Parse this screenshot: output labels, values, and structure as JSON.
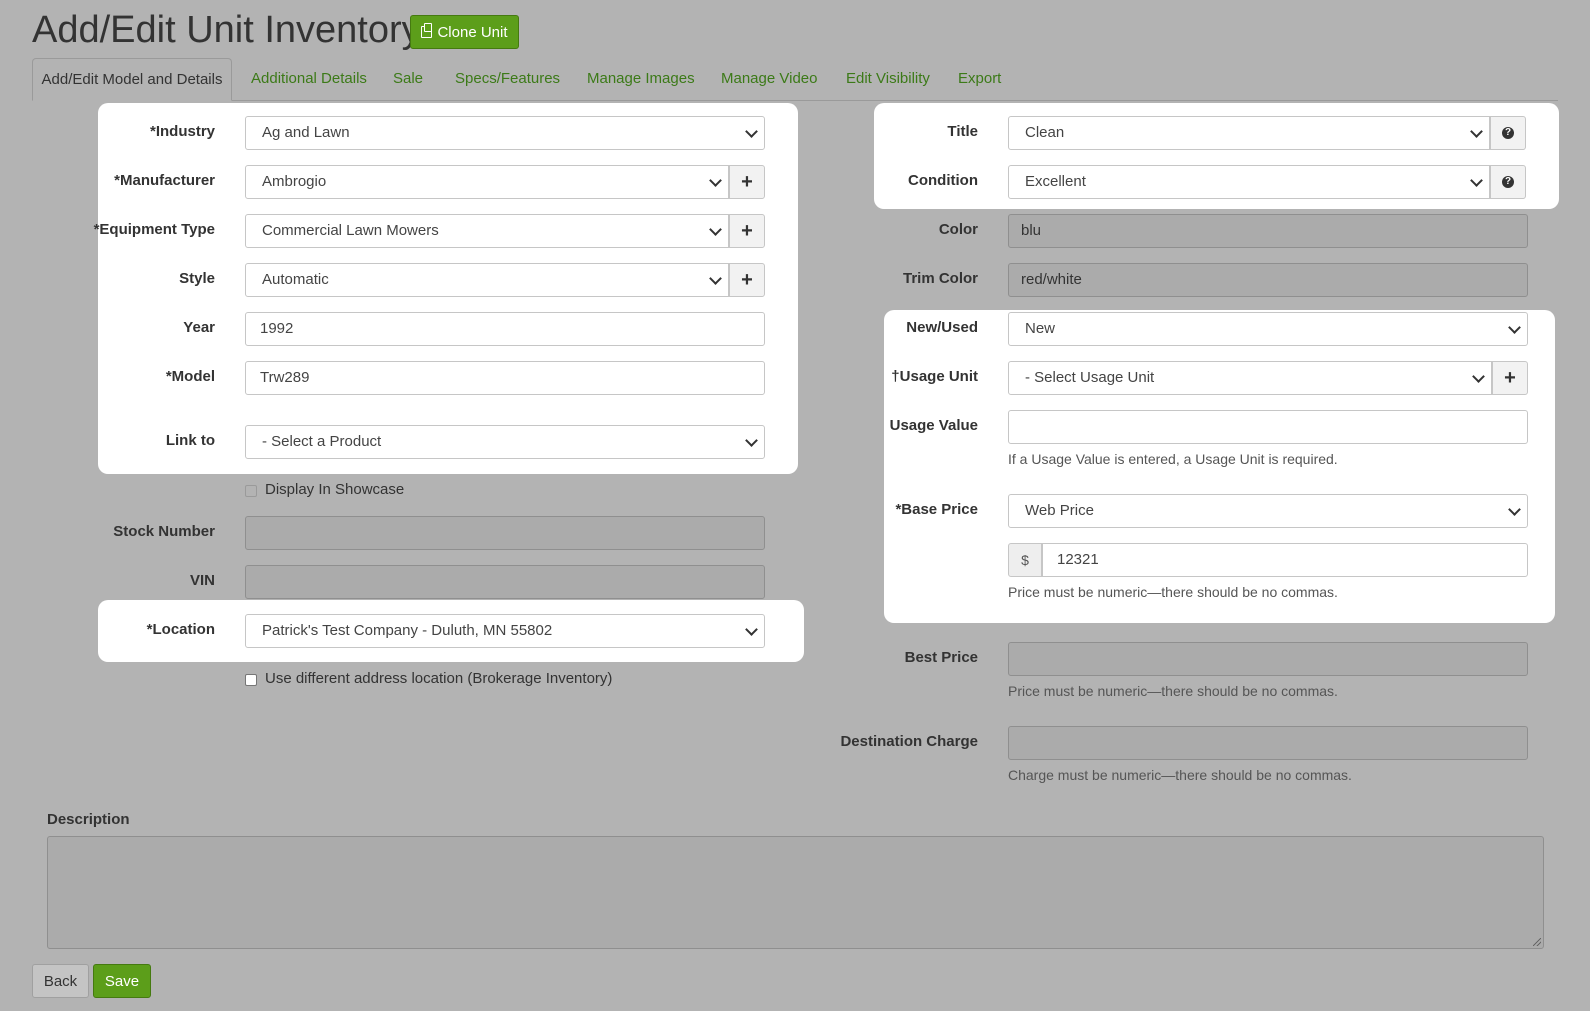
{
  "page": {
    "title": "Add/Edit Unit Inventory",
    "clone_button": "Clone Unit"
  },
  "tabs": [
    {
      "label": "Add/Edit Model and Details",
      "active": true
    },
    {
      "label": "Additional Details"
    },
    {
      "label": "Sale"
    },
    {
      "label": "Specs/Features"
    },
    {
      "label": "Manage Images"
    },
    {
      "label": "Manage Video"
    },
    {
      "label": "Edit Visibility"
    },
    {
      "label": "Export"
    }
  ],
  "left": {
    "industry": {
      "label": "*Industry",
      "value": "Ag and Lawn"
    },
    "manufacturer": {
      "label": "*Manufacturer",
      "value": "Ambrogio"
    },
    "equipment_type": {
      "label": "*Equipment Type",
      "value": "Commercial Lawn Mowers"
    },
    "style": {
      "label": "Style",
      "value": "Automatic"
    },
    "year": {
      "label": "Year",
      "value": "1992"
    },
    "model": {
      "label": "*Model",
      "value": "Trw289"
    },
    "link_to": {
      "label": "Link to",
      "value": "- Select a Product"
    },
    "display_showcase": {
      "label": "Display In Showcase",
      "checked": false
    },
    "stock_number": {
      "label": "Stock Number",
      "value": ""
    },
    "vin": {
      "label": "VIN",
      "value": ""
    },
    "location": {
      "label": "*Location",
      "value": "Patrick's Test Company - Duluth, MN 55802"
    },
    "different_address": {
      "label": "Use different address location (Brokerage Inventory)",
      "checked": false
    }
  },
  "right": {
    "title": {
      "label": "Title",
      "value": "Clean"
    },
    "condition": {
      "label": "Condition",
      "value": "Excellent"
    },
    "color": {
      "label": "Color",
      "value": "blu"
    },
    "trim_color": {
      "label": "Trim Color",
      "value": "red/white"
    },
    "new_used": {
      "label": "New/Used",
      "value": "New"
    },
    "usage_unit": {
      "label": "†Usage Unit",
      "value": "- Select Usage Unit"
    },
    "usage_value": {
      "label": "Usage Value",
      "value": "",
      "help": "If a Usage Value is entered, a Usage Unit is required."
    },
    "base_price": {
      "label": "*Base Price",
      "value": "Web Price",
      "currency": "$",
      "amount": "12321",
      "help": "Price must be numeric—there should be no commas."
    },
    "best_price": {
      "label": "Best Price",
      "value": "",
      "help": "Price must be numeric—there should be no commas."
    },
    "destination_charge": {
      "label": "Destination Charge",
      "value": "",
      "help": "Charge must be numeric—there should be no commas."
    }
  },
  "description": {
    "label": "Description",
    "value": ""
  },
  "footer": {
    "back": "Back",
    "save": "Save"
  },
  "colors": {
    "background": "#b3b3b3",
    "accent_green": "#5c9e1a",
    "link_green": "#3c7a18"
  }
}
